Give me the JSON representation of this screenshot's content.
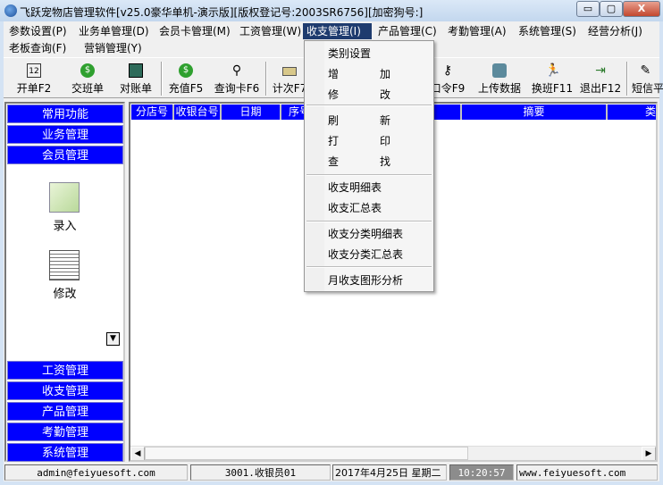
{
  "window": {
    "title": "飞跃宠物店管理软件[v25.0豪华单机-演示版][版权登记号:2003SR6756][加密狗号:]",
    "minimize": "▭",
    "maximize": "▢",
    "close": "X"
  },
  "menubar": [
    {
      "label": "参数设置(P)"
    },
    {
      "label": "业务单管理(D)"
    },
    {
      "label": "会员卡管理(M)"
    },
    {
      "label": "工资管理(W)"
    },
    {
      "label": "收支管理(I)",
      "active": true
    },
    {
      "label": "产品管理(C)"
    },
    {
      "label": "考勤管理(A)"
    },
    {
      "label": "系统管理(S)"
    },
    {
      "label": "经营分析(J)"
    },
    {
      "label": "老板查询(F)"
    },
    {
      "label": "营销管理(Y)"
    }
  ],
  "dropdown": {
    "items": [
      "类别设置",
      [
        "增",
        "加"
      ],
      [
        "修",
        "改"
      ],
      [
        "刷",
        "新"
      ],
      [
        "打",
        "印"
      ],
      [
        "查",
        "找"
      ],
      "收支明细表",
      "收支汇总表",
      "收支分类明细表",
      "收支分类汇总表",
      "月收支图形分析"
    ]
  },
  "toolbar": [
    {
      "label": "开单F2",
      "icon": "calculator-icon"
    },
    {
      "label": "交班单",
      "icon": "money-bag-icon"
    },
    {
      "label": "对账单",
      "icon": "ledger-icon"
    },
    {
      "label": "充值F5",
      "icon": "money-bag-icon"
    },
    {
      "label": "查询卡F6",
      "icon": "binoculars-icon"
    },
    {
      "label": "计次F7",
      "icon": "counter-icon"
    },
    {
      "label": "口令F9",
      "icon": "key-icon"
    },
    {
      "label": "上传数据",
      "icon": "upload-icon"
    },
    {
      "label": "换班F11",
      "icon": "runner-icon"
    },
    {
      "label": "退出F12",
      "icon": "exit-door-icon"
    },
    {
      "label": "短信平",
      "icon": "sms-icon"
    }
  ],
  "left_panel": {
    "top_groups": [
      "常用功能",
      "业务管理",
      "会员管理"
    ],
    "items": [
      {
        "label": "录入",
        "icon": "notepad-pen-icon"
      },
      {
        "label": "修改",
        "icon": "document-edit-icon"
      }
    ],
    "scroll_down": "▼",
    "bottom_groups": [
      "工资管理",
      "收支管理",
      "产品管理",
      "考勤管理",
      "系统管理"
    ]
  },
  "grid": {
    "columns": [
      "分店号",
      "收银台号",
      "日期",
      "序号",
      "摘要",
      "类"
    ]
  },
  "statusbar": {
    "user": "admin@feiyuesoft.com",
    "cashier": "3001.收银员01",
    "date": "2017年4月25日  星期二",
    "time": "10:20:57",
    "website": "www.feiyuesoft.com"
  },
  "colors": {
    "group_button": "#0000ff",
    "menu_active": "#1e3b6e",
    "grid_header": "#0000ff"
  }
}
